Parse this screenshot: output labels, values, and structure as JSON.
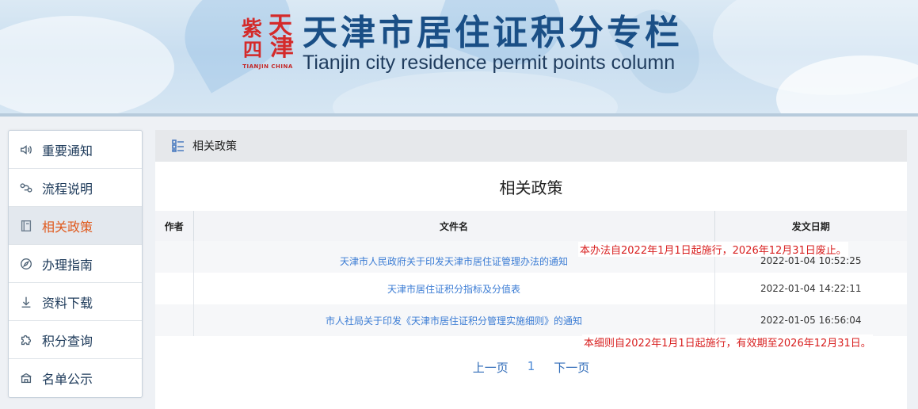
{
  "header": {
    "logo_chars": [
      "天",
      "津",
      "紫",
      "四"
    ],
    "logo_sub": "TIANJIN CHINA",
    "title_cn": "天津市居住证积分专栏",
    "title_en": "Tianjin city residence permit points column"
  },
  "sidebar": {
    "items": [
      {
        "label": "重要通知",
        "icon": "speaker-icon"
      },
      {
        "label": "流程说明",
        "icon": "flow-link-icon"
      },
      {
        "label": "相关政策",
        "icon": "book-icon",
        "active": true
      },
      {
        "label": "办理指南",
        "icon": "compass-icon"
      },
      {
        "label": "资料下载",
        "icon": "download-icon"
      },
      {
        "label": "积分查询",
        "icon": "puzzle-icon"
      },
      {
        "label": "名单公示",
        "icon": "building-icon"
      }
    ]
  },
  "breadcrumb": {
    "label": "相关政策",
    "icon": "list-icon"
  },
  "page_title": "相关政策",
  "table": {
    "headers": [
      "作者",
      "文件名",
      "发文日期"
    ],
    "rows": [
      {
        "author": "",
        "title": "天津市人民政府关于印发天津市居住证管理办法的通知",
        "date": "2022-01-04 10:52:25"
      },
      {
        "author": "",
        "title": "天津市居住证积分指标及分值表",
        "date": "2022-01-04 14:22:11"
      },
      {
        "author": "",
        "title": "市人社局关于印发《天津市居住证积分管理实施细则》的通知",
        "date": "2022-01-05 16:56:04"
      }
    ]
  },
  "notes": [
    "本办法自2022年1月1日起施行，2026年12月31日废止。",
    "本细则自2022年1月1日起施行，有效期至2026年12月31日。"
  ],
  "pagination": {
    "prev": "上一页",
    "current": "1",
    "next": "下一页"
  },
  "colors": {
    "accent": "#e0591c",
    "link": "#3b7cd4",
    "note": "#d81e1e",
    "title": "#1a4f86"
  }
}
